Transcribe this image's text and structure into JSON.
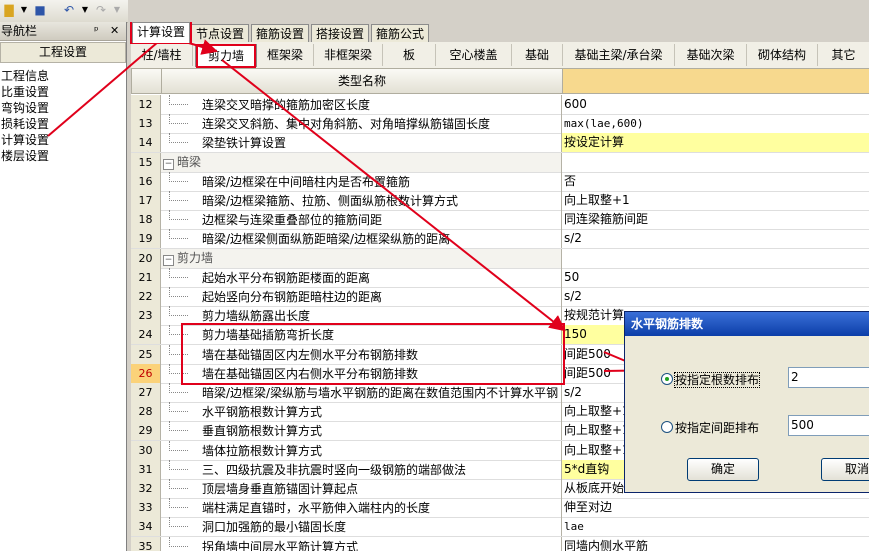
{
  "toolbar": {
    "icons": [
      "open-folder-icon",
      "save-icon",
      "undo-icon",
      "redo-icon"
    ]
  },
  "nav": {
    "title": "导航栏",
    "pin": "ᵖ",
    "close": "✕",
    "section": "工程设置",
    "items": [
      "工程信息",
      "比重设置",
      "弯钩设置",
      "损耗设置",
      "计算设置",
      "楼层设置"
    ]
  },
  "tabs": [
    "计算设置",
    "节点设置",
    "箍筋设置",
    "搭接设置",
    "箍筋公式"
  ],
  "subtabs": [
    "柱/墙柱",
    "剪力墙",
    "框架梁",
    "非框架梁",
    "板",
    "空心楼盖",
    "基础",
    "基础主梁/承台梁",
    "基础次梁",
    "砌体结构",
    "其它"
  ],
  "grid": {
    "header_name": "类型名称",
    "rows": [
      {
        "n": "12",
        "name": "连梁交叉暗撑的箍筋加密区长度",
        "value": "600"
      },
      {
        "n": "13",
        "name": "连梁交叉斜筋、集中对角斜筋、对角暗撑纵筋锚固长度",
        "value": "max(lae,600)"
      },
      {
        "n": "14",
        "name": "梁垫铁计算设置",
        "value": "按设定计算"
      },
      {
        "n": "15",
        "name": "暗梁",
        "value": ""
      },
      {
        "n": "16",
        "name": "暗梁/边框梁在中间暗柱内是否布置箍筋",
        "value": "否"
      },
      {
        "n": "17",
        "name": "暗梁/边框梁箍筋、拉筋、侧面纵筋根数计算方式",
        "value": "向上取整+1"
      },
      {
        "n": "18",
        "name": "边框梁与连梁重叠部位的箍筋间距",
        "value": "同连梁箍筋间距"
      },
      {
        "n": "19",
        "name": "暗梁/边框梁侧面纵筋距暗梁/边框梁纵筋的距离",
        "value": "s/2"
      },
      {
        "n": "20",
        "name": "剪力墙",
        "value": ""
      },
      {
        "n": "21",
        "name": "起始水平分布钢筋距楼面的距离",
        "value": "50"
      },
      {
        "n": "22",
        "name": "起始竖向分布钢筋距暗柱边的距离",
        "value": "s/2"
      },
      {
        "n": "23",
        "name": "剪力墙纵筋露出长度",
        "value": "按规范计算"
      },
      {
        "n": "24",
        "name": "剪力墙基础插筋弯折长度",
        "value": "150"
      },
      {
        "n": "25",
        "name": "墙在基础锚固区内左侧水平分布钢筋排数",
        "value": "间距500"
      },
      {
        "n": "26",
        "name": "墙在基础锚固区内右侧水平分布钢筋排数",
        "value": "间距500"
      },
      {
        "n": "27",
        "name": "暗梁/边框梁/梁纵筋与墙水平钢筋的距离在数值范围内不计算水平钢",
        "value": "s/2"
      },
      {
        "n": "28",
        "name": "水平钢筋根数计算方式",
        "value": "向上取整+1"
      },
      {
        "n": "29",
        "name": "垂直钢筋根数计算方式",
        "value": "向上取整+1"
      },
      {
        "n": "30",
        "name": "墙体拉筋根数计算方式",
        "value": "向上取整+1"
      },
      {
        "n": "31",
        "name": "三、四级抗震及非抗震时竖向一级钢筋的端部做法",
        "value": "5*d直钩"
      },
      {
        "n": "32",
        "name": "顶层墙身垂直筋锚固计算起点",
        "value": "从板底开始"
      },
      {
        "n": "33",
        "name": "端柱满足直锚时，水平筋伸入端柱内的长度",
        "value": "伸至对边"
      },
      {
        "n": "34",
        "name": "洞口加强筋的最小锚固长度",
        "value": "lae"
      },
      {
        "n": "35",
        "name": "拐角墙中间层水平筋计算方式",
        "value": "同墙内侧水平筋"
      }
    ]
  },
  "dialog": {
    "title": "水平钢筋排数",
    "option1": "按指定根数排布",
    "value1": "2",
    "option2": "按指定间距排布",
    "value2": "500",
    "ok": "确定",
    "cancel": "取消"
  },
  "colors": {
    "annotation": "#e0001b",
    "header_value": "#f7d98e",
    "highlight": "#ffff9f",
    "dialog_title": "#0b3ea8"
  }
}
